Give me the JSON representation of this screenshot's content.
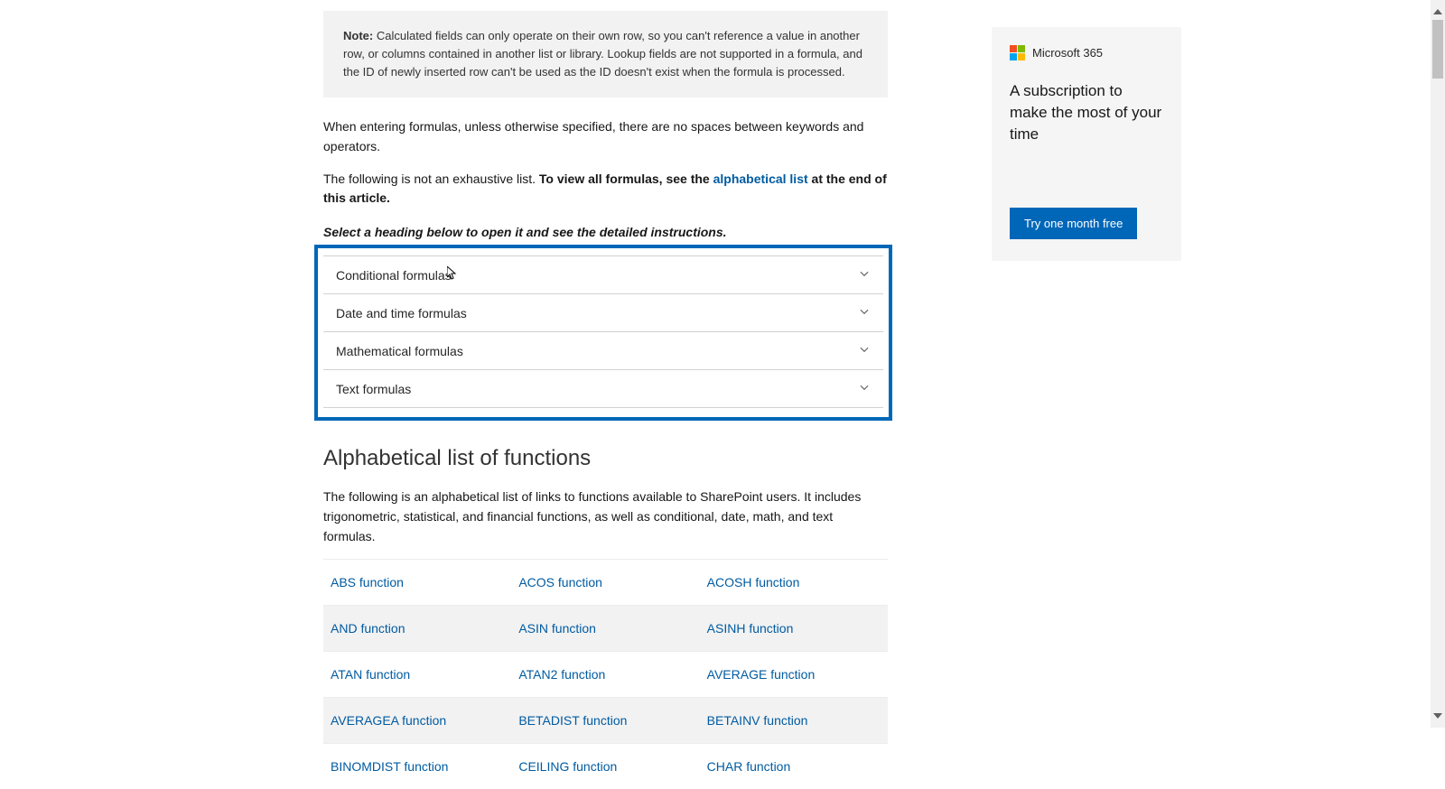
{
  "note": {
    "label": "Note:",
    "text": "Calculated fields can only operate on their own row, so you can't reference a value in another row, or columns contained in another list or library. Lookup fields are not supported in a formula, and the ID of newly inserted row can't be used as the ID doesn't exist when the formula is processed."
  },
  "p1": "When entering formulas, unless otherwise specified, there are no spaces between keywords and operators.",
  "p2a": "The following is not an exhaustive list. ",
  "p2b": "To view all formulas, see the ",
  "p2link": "alphabetical list",
  "p2c": " at the end of this article.",
  "selectHeading": "Select a heading below to open it and see the detailed instructions.",
  "accordion": [
    {
      "label": "Conditional formulas"
    },
    {
      "label": "Date and time formulas"
    },
    {
      "label": "Mathematical formulas"
    },
    {
      "label": "Text formulas"
    }
  ],
  "alphaTitle": "Alphabetical list of functions",
  "alphaPara": "The following is an alphabetical list of links to functions available to SharePoint users. It includes trigonometric, statistical, and financial functions, as well as conditional, date, math, and text formulas.",
  "functions": [
    [
      "ABS function",
      "ACOS function",
      "ACOSH function"
    ],
    [
      "AND function",
      "ASIN function",
      "ASINH function"
    ],
    [
      "ATAN function",
      "ATAN2 function",
      "AVERAGE function"
    ],
    [
      "AVERAGEA function",
      "BETADIST function",
      "BETAINV function"
    ],
    [
      "BINOMDIST function",
      "CEILING function",
      "CHAR function"
    ]
  ],
  "promo": {
    "product": "Microsoft 365",
    "tagline": "A subscription to make the most of your time",
    "cta": "Try one month free"
  }
}
